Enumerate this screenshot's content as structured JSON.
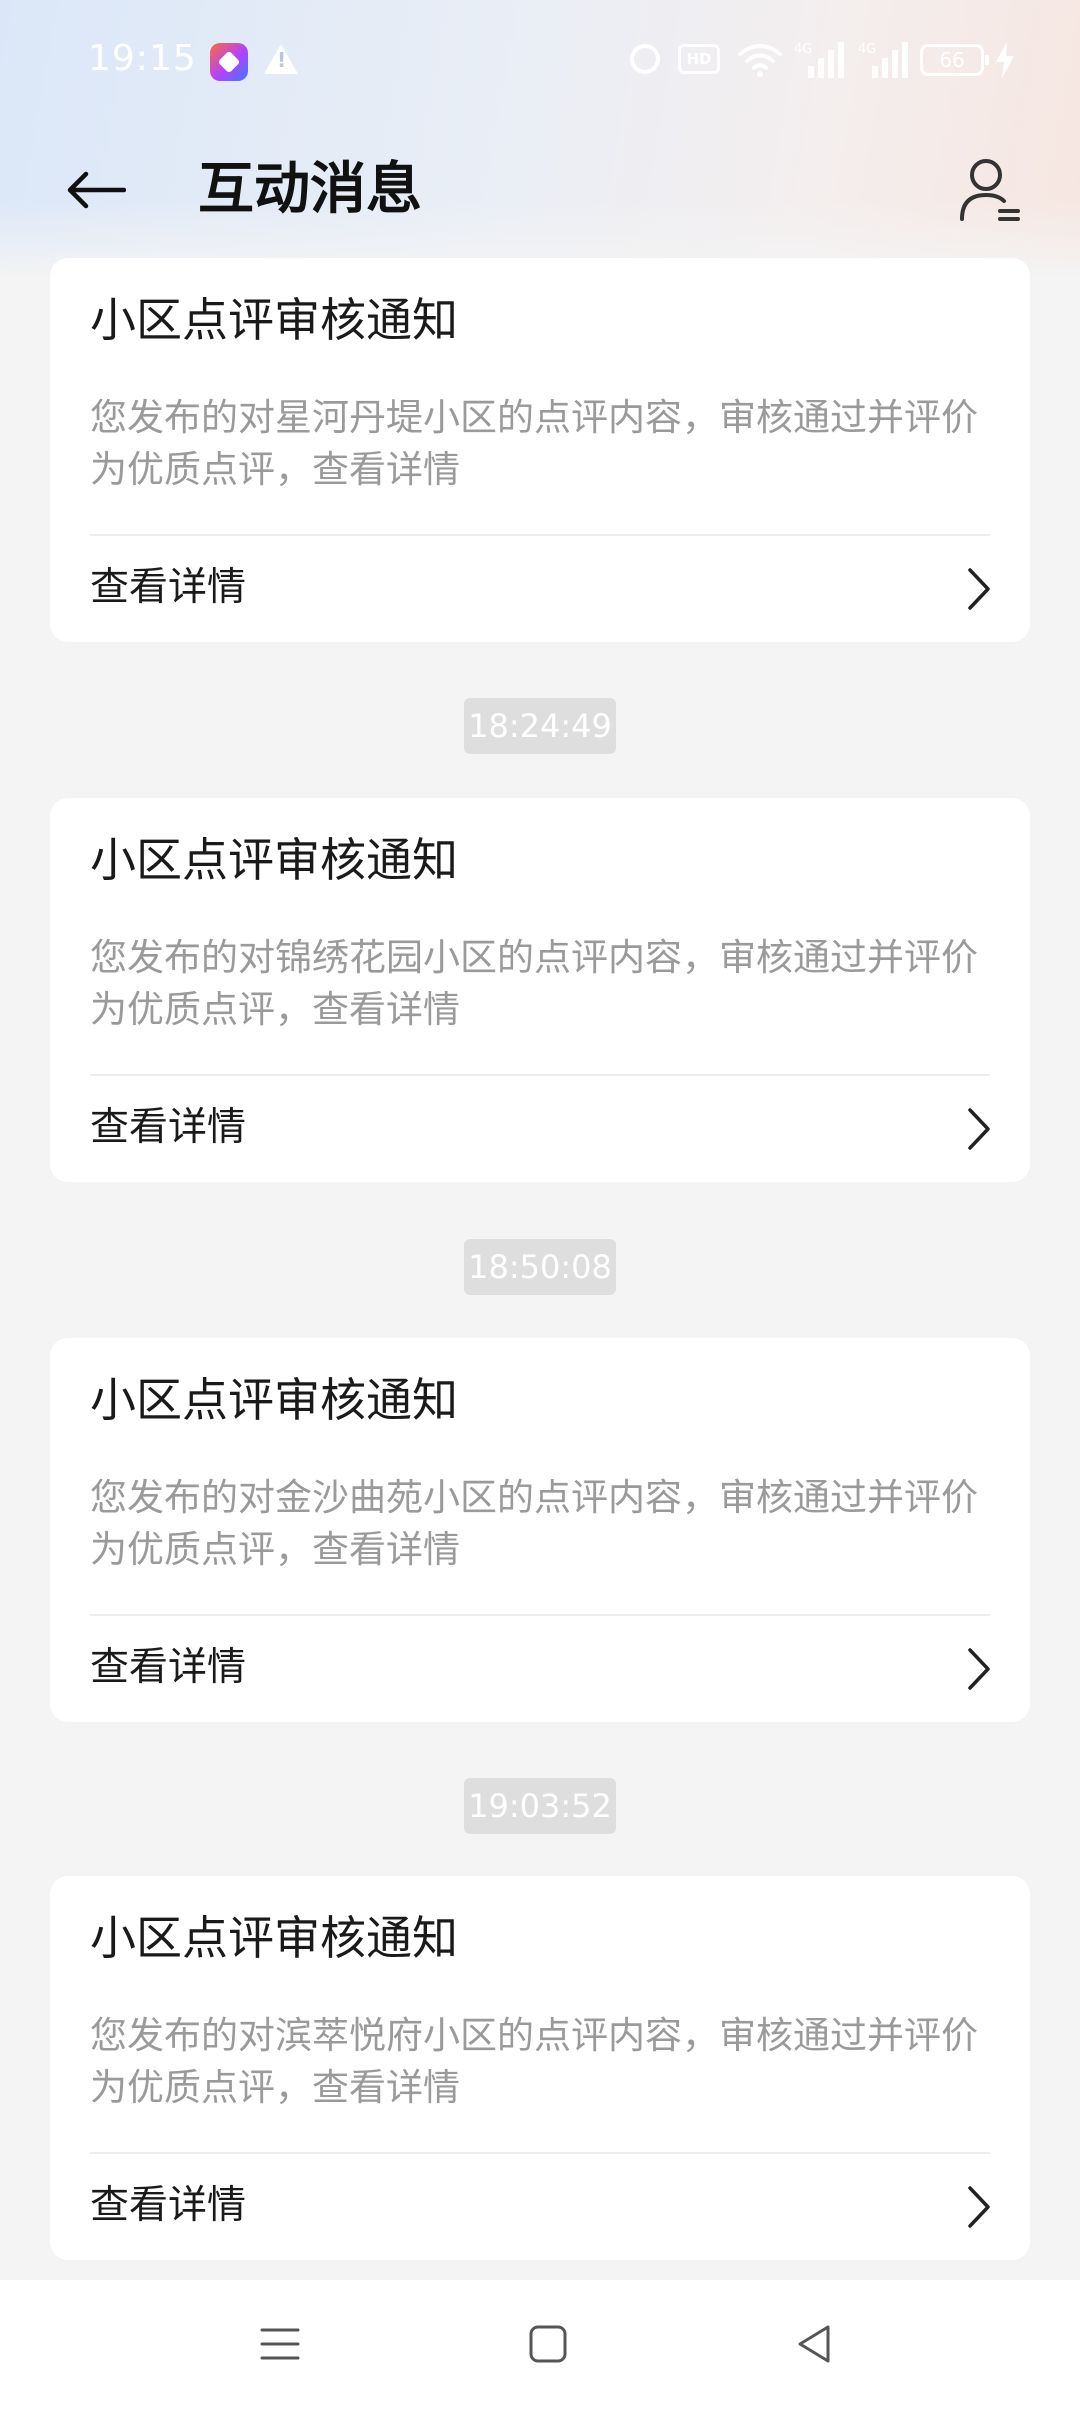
{
  "status_bar": {
    "time": "19:15",
    "hd_label": "HD",
    "signal_1_label": "4G",
    "signal_2_label": "4G",
    "battery": "66"
  },
  "header": {
    "title": "互动消息"
  },
  "messages": [
    {
      "title": "小区点评审核通知",
      "body": "您发布的对星河丹堤小区的点评内容，审核通过并评价为优质点评，查看详情",
      "link_label": "查看详情"
    },
    {
      "timestamp": "18:24:49",
      "title": "小区点评审核通知",
      "body": "您发布的对锦绣花园小区的点评内容，审核通过并评价为优质点评，查看详情",
      "link_label": "查看详情"
    },
    {
      "timestamp": "18:50:08",
      "title": "小区点评审核通知",
      "body": "您发布的对金沙曲苑小区的点评内容，审核通过并评价为优质点评，查看详情",
      "link_label": "查看详情"
    },
    {
      "timestamp": "19:03:52",
      "title": "小区点评审核通知",
      "body": "您发布的对滨萃悦府小区的点评内容，审核通过并评价为优质点评，查看详情",
      "link_label": "查看详情"
    }
  ],
  "icons": {
    "back": "back-arrow-icon",
    "user": "user-settings-icon",
    "chevron": "chevron-right-icon",
    "nav_menu": "menu-icon",
    "nav_home": "home-square-icon",
    "nav_back": "back-triangle-icon"
  }
}
